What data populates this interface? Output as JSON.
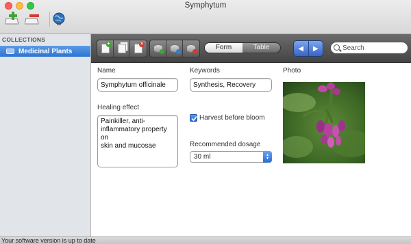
{
  "window": {
    "title": "Symphytum"
  },
  "top_toolbar": {
    "items": [
      "add-collection-icon",
      "remove-collection-icon",
      "online-globe-icon"
    ]
  },
  "sidebar": {
    "header": "COLLECTIONS",
    "items": [
      {
        "label": "Medicinal Plants",
        "icon": "collection-icon",
        "selected": true
      }
    ]
  },
  "toolbar": {
    "record_buttons": [
      "new-record-icon",
      "duplicate-record-icon",
      "delete-record-icon"
    ],
    "field_buttons": [
      "add-field-icon",
      "edit-field-icon",
      "remove-field-icon"
    ],
    "view_modes": [
      {
        "label": "Form",
        "active": true
      },
      {
        "label": "Table",
        "active": false
      }
    ],
    "nav": {
      "prev": "◀",
      "next": "▶"
    },
    "search": {
      "placeholder": "Search",
      "value": ""
    }
  },
  "form": {
    "name": {
      "label": "Name",
      "value": "Symphytum officinale"
    },
    "keywords": {
      "label": "Keywords",
      "value": "Synthesis, Recovery"
    },
    "photo": {
      "label": "Photo"
    },
    "healing_effect": {
      "label": "Healing effect",
      "value": "Painkiller, anti-\ninflammatory property on\nskin and mucosae"
    },
    "harvest": {
      "label": "Harvest before bloom",
      "checked": true
    },
    "dosage": {
      "label": "Recommended dosage",
      "value": "30 ml"
    }
  },
  "status": {
    "text": "Your software version is up to date"
  },
  "colors": {
    "selection": "#2e74d0",
    "accent": "#3863c4"
  }
}
